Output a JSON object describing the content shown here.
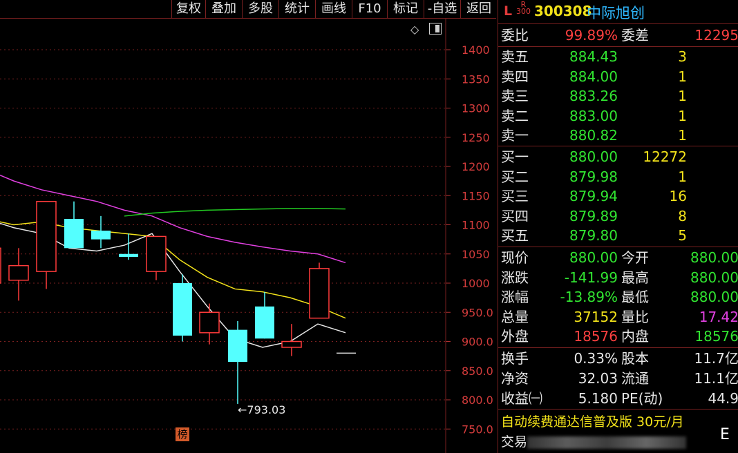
{
  "toolbar": {
    "buttons": [
      "复权",
      "叠加",
      "多股",
      "统计",
      "画线",
      "F10",
      "标记",
      "-自选",
      "返回"
    ]
  },
  "chart": {
    "y_ticks": [
      "1400",
      "1350",
      "1300",
      "1250",
      "1200",
      "1150",
      "1100",
      "1050",
      "1000",
      "950.0",
      "900.0",
      "850.0",
      "800.0",
      "750.0"
    ],
    "low_marker": "793.03",
    "bang_label": "榜",
    "icons": [
      "diamond-icon",
      "panel-toggle-icon"
    ]
  },
  "chart_data": {
    "type": "candlestick",
    "ylim": [
      735,
      1430
    ],
    "candles": [
      {
        "open": 1000,
        "close": 1060,
        "high": 1060,
        "low": 990
      },
      {
        "open": 1005,
        "close": 1030,
        "high": 1060,
        "low": 970
      },
      {
        "open": 1020,
        "close": 1140,
        "high": 1140,
        "low": 990
      },
      {
        "open": 1110,
        "close": 1060,
        "high": 1140,
        "low": 1060
      },
      {
        "open": 1090,
        "close": 1075,
        "high": 1115,
        "low": 1060
      },
      {
        "open": 1050,
        "close": 1045,
        "high": 1085,
        "low": 1040
      },
      {
        "open": 1020,
        "close": 1080,
        "high": 1080,
        "low": 1005
      },
      {
        "open": 1000,
        "close": 910,
        "high": 1015,
        "low": 900
      },
      {
        "open": 915,
        "close": 950,
        "high": 965,
        "low": 895
      },
      {
        "open": 920,
        "close": 865,
        "high": 935,
        "low": 793.03
      },
      {
        "open": 960,
        "close": 905,
        "high": 985,
        "low": 905
      },
      {
        "open": 890,
        "close": 900,
        "high": 930,
        "low": 875
      },
      {
        "open": 940,
        "close": 1025,
        "high": 1035,
        "low": 940
      }
    ],
    "ma_series": [
      {
        "color": "#e6e6e6",
        "values": [
          1110,
          1095,
          1085,
          1060,
          1055,
          1065,
          1085,
          1020,
          960,
          905,
          890,
          900,
          930,
          915
        ]
      },
      {
        "color": "#f2e21a",
        "values": [
          1110,
          1100,
          1105,
          1095,
          1090,
          1085,
          1080,
          1040,
          1010,
          990,
          985,
          975,
          960,
          940
        ]
      },
      {
        "color": "#e040e0",
        "values": [
          1195,
          1175,
          1160,
          1150,
          1140,
          1125,
          1115,
          1095,
          1080,
          1070,
          1062,
          1055,
          1050,
          1035
        ]
      },
      {
        "color": "#22c922",
        "values": [
          null,
          null,
          null,
          null,
          null,
          1115,
          1120,
          1123,
          1125,
          1126,
          1127,
          1128,
          1128,
          1127
        ]
      }
    ],
    "current_price_line": 880.0
  },
  "panel": {
    "header": {
      "L": "L",
      "R": "R",
      "R_sub": "300",
      "code": "300308",
      "name": "中际旭创"
    },
    "weibi": {
      "label": "委比",
      "value": "99.89%",
      "label2": "委差",
      "value2": "12295"
    },
    "asks": [
      {
        "label": "卖五",
        "price": "884.43",
        "vol": "3"
      },
      {
        "label": "卖四",
        "price": "884.00",
        "vol": "1"
      },
      {
        "label": "卖三",
        "price": "883.26",
        "vol": "1"
      },
      {
        "label": "卖二",
        "price": "883.00",
        "vol": "1"
      },
      {
        "label": "卖一",
        "price": "880.82",
        "vol": "1"
      }
    ],
    "bids": [
      {
        "label": "买一",
        "price": "880.00",
        "vol": "12272"
      },
      {
        "label": "买二",
        "price": "879.98",
        "vol": "1"
      },
      {
        "label": "买三",
        "price": "879.94",
        "vol": "16"
      },
      {
        "label": "买四",
        "price": "879.89",
        "vol": "8"
      },
      {
        "label": "买五",
        "price": "879.80",
        "vol": "5"
      }
    ],
    "quotes": [
      {
        "l1": "现价",
        "v1": "880.00",
        "c1": "green",
        "l2": "今开",
        "v2": "880.00",
        "c2": "green"
      },
      {
        "l1": "涨跌",
        "v1": "-141.99",
        "c1": "green",
        "l2": "最高",
        "v2": "880.00",
        "c2": "green"
      },
      {
        "l1": "涨幅",
        "v1": "-13.89%",
        "c1": "green",
        "l2": "最低",
        "v2": "880.00",
        "c2": "green"
      },
      {
        "l1": "总量",
        "v1": "37152",
        "c1": "yellow",
        "l2": "量比",
        "v2": "17.42",
        "c2": "magenta"
      },
      {
        "l1": "外盘",
        "v1": "18576",
        "c1": "red",
        "l2": "内盘",
        "v2": "18576",
        "c2": "green"
      }
    ],
    "fundamentals": [
      {
        "l1": "换手",
        "v1": "0.33%",
        "l2": "股本",
        "v2": "11.7亿"
      },
      {
        "l1": "净资",
        "v1": "32.03",
        "l2": "流通",
        "v2": "11.1亿"
      },
      {
        "l1": "收益㈠",
        "v1": "5.180",
        "l2": "PE(动)",
        "v2": "44.9"
      }
    ],
    "ad_line": "自动续费通达信普及版 30元/月",
    "ad_line2_prefix": "交易",
    "e_icon": "E"
  }
}
